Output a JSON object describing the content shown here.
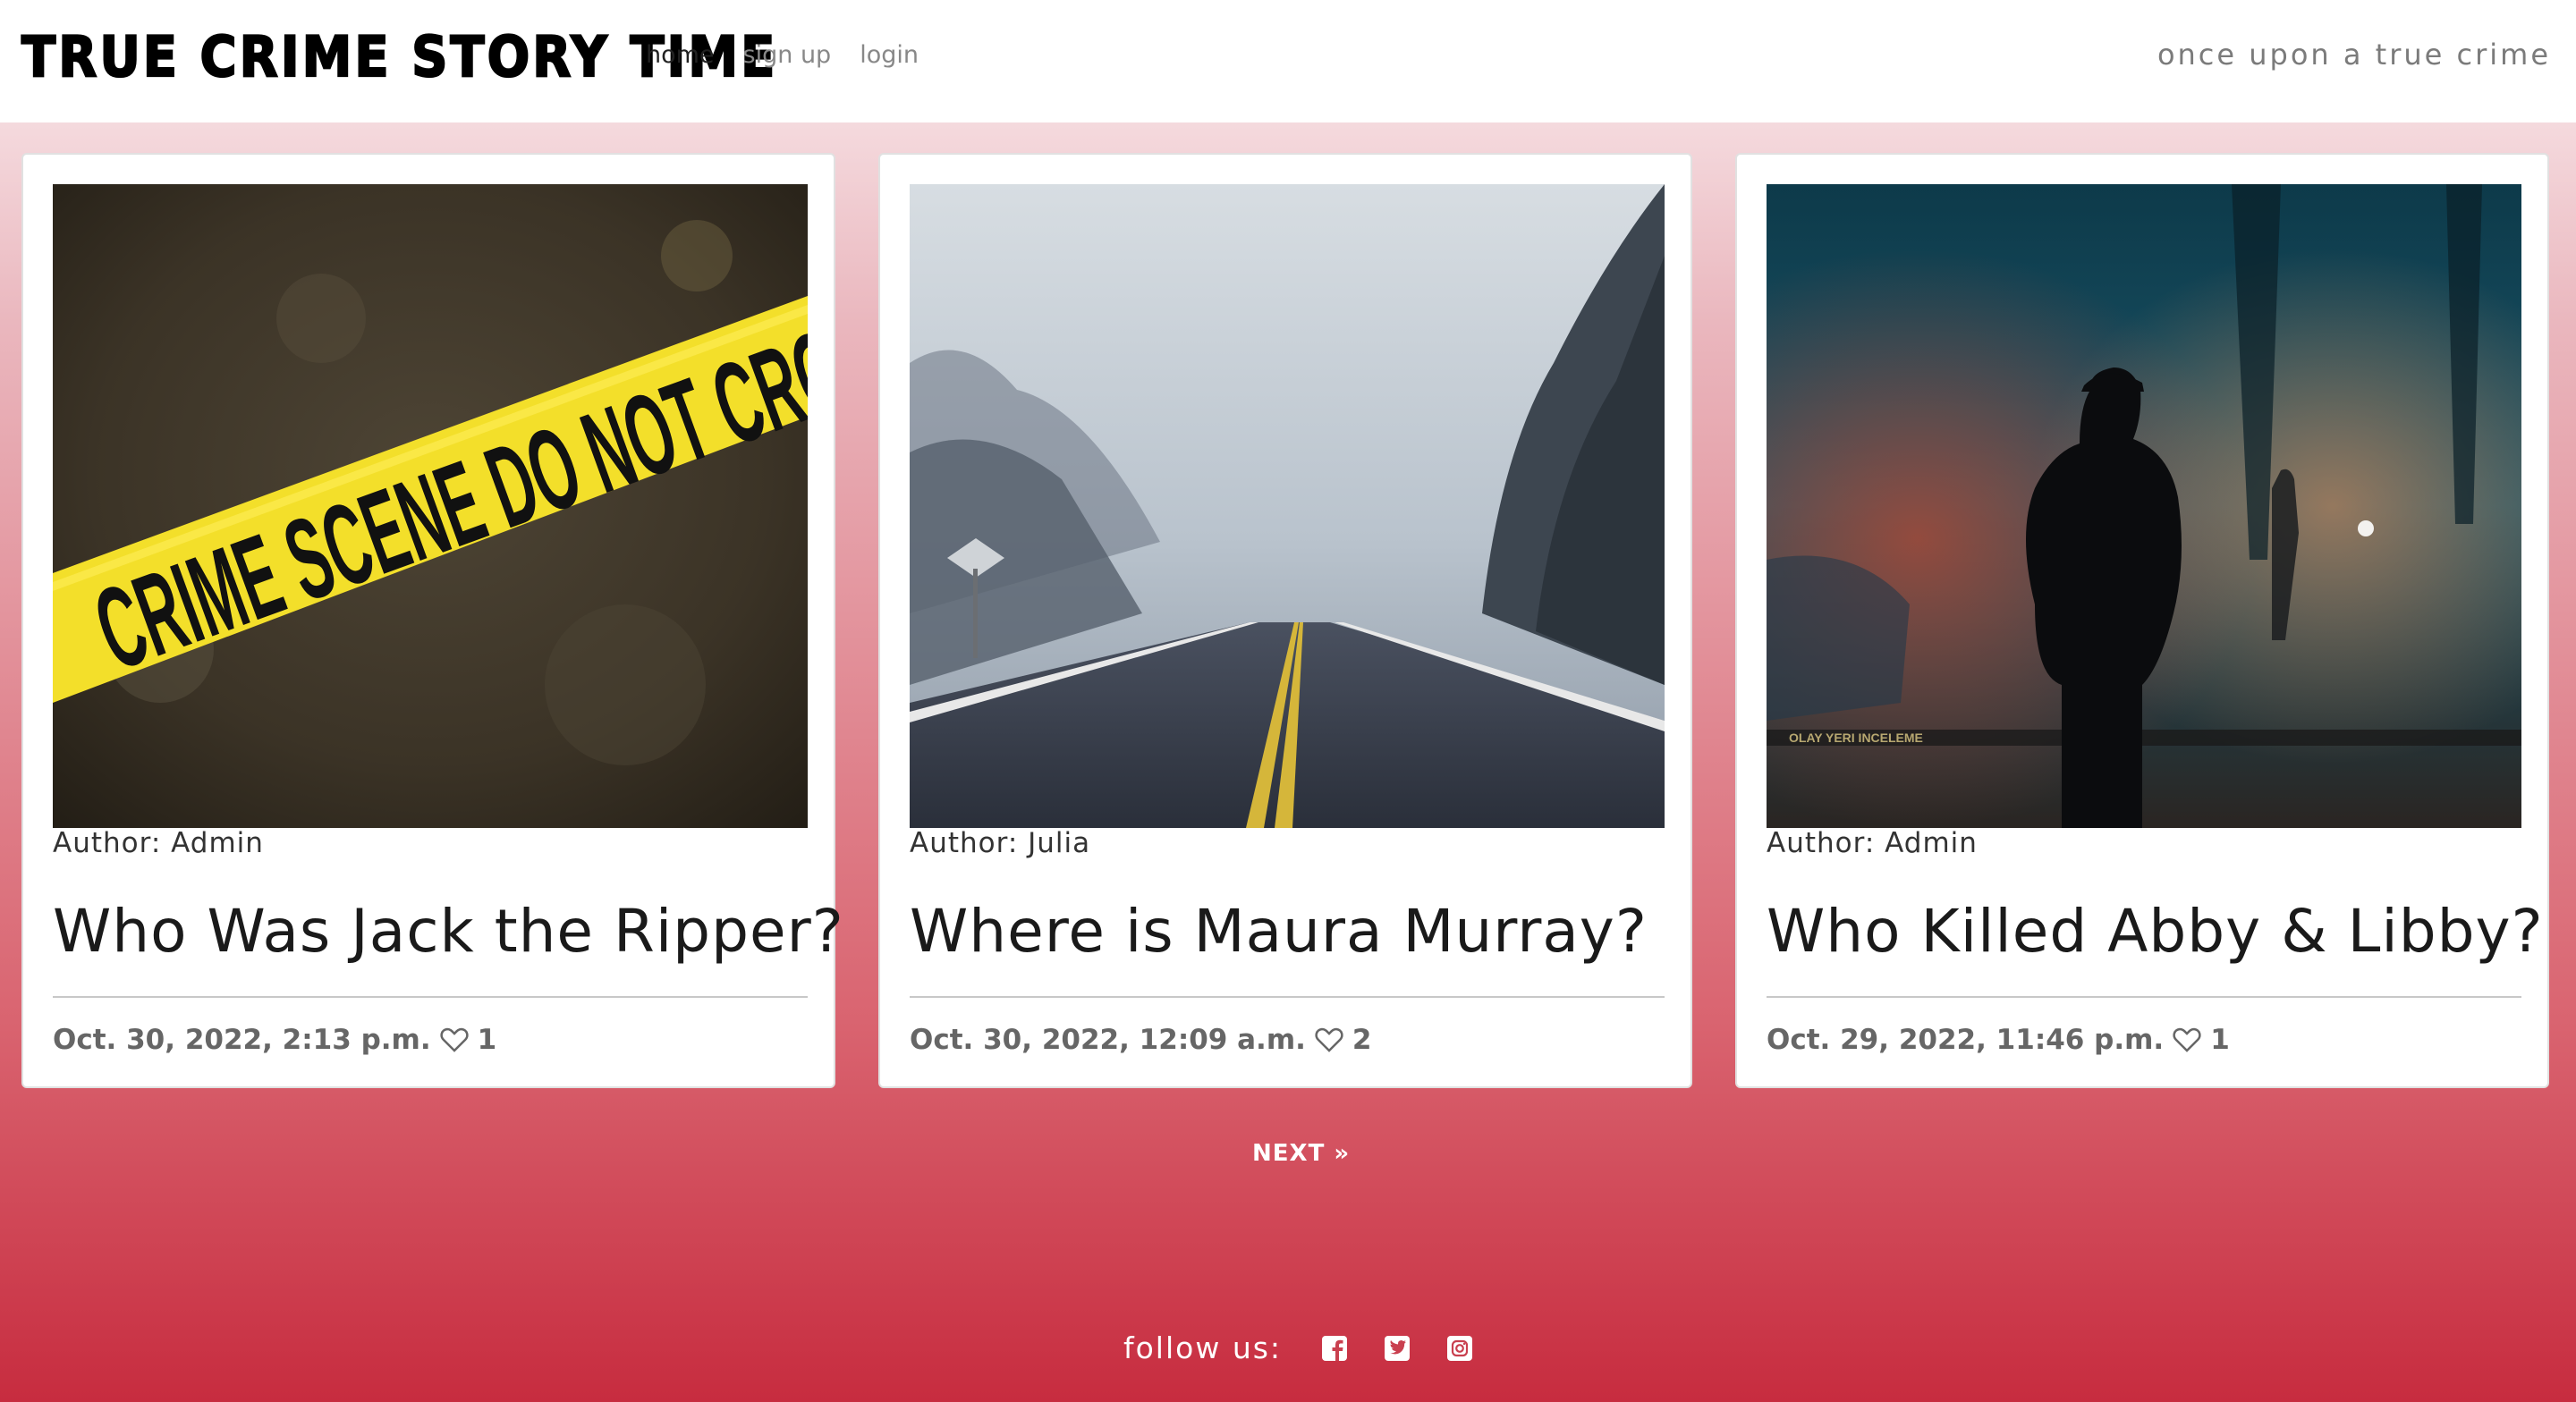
{
  "nav": {
    "brand": "TRUE CRIME STORY TIME",
    "links": [
      {
        "label": "home",
        "active": true
      },
      {
        "label": "sign up",
        "active": false
      },
      {
        "label": "login",
        "active": false
      }
    ],
    "tagline": "once upon a true crime"
  },
  "posts": [
    {
      "author": "Author: Admin",
      "title": "Who Was Jack the Ripper?",
      "date": "Oct. 30, 2022, 2:13 p.m.",
      "likes": "1",
      "image": "crime-scene-tape-photo",
      "image_text": "CRIME SCENE DO NOT CROSS"
    },
    {
      "author": "Author: Julia",
      "title": "Where is Maura Murray?",
      "date": "Oct. 30, 2022, 12:09 a.m.",
      "likes": "2",
      "image": "foggy-road-photo"
    },
    {
      "author": "Author: Admin",
      "title": "Who Killed Abby & Libby?",
      "date": "Oct. 29, 2022, 11:46 p.m.",
      "likes": "1",
      "image": "police-officer-silhouette-photo",
      "image_text": "OLAY YERI INCELEME"
    }
  ],
  "pagination": {
    "next_label": "NEXT »"
  },
  "footer": {
    "follow_label": "follow us:",
    "icons": [
      "facebook-icon",
      "twitter-icon",
      "instagram-icon"
    ]
  },
  "colors": {
    "accent": "#c72c3f",
    "navbar": "#ffffff",
    "tape": "#f3df2a"
  }
}
